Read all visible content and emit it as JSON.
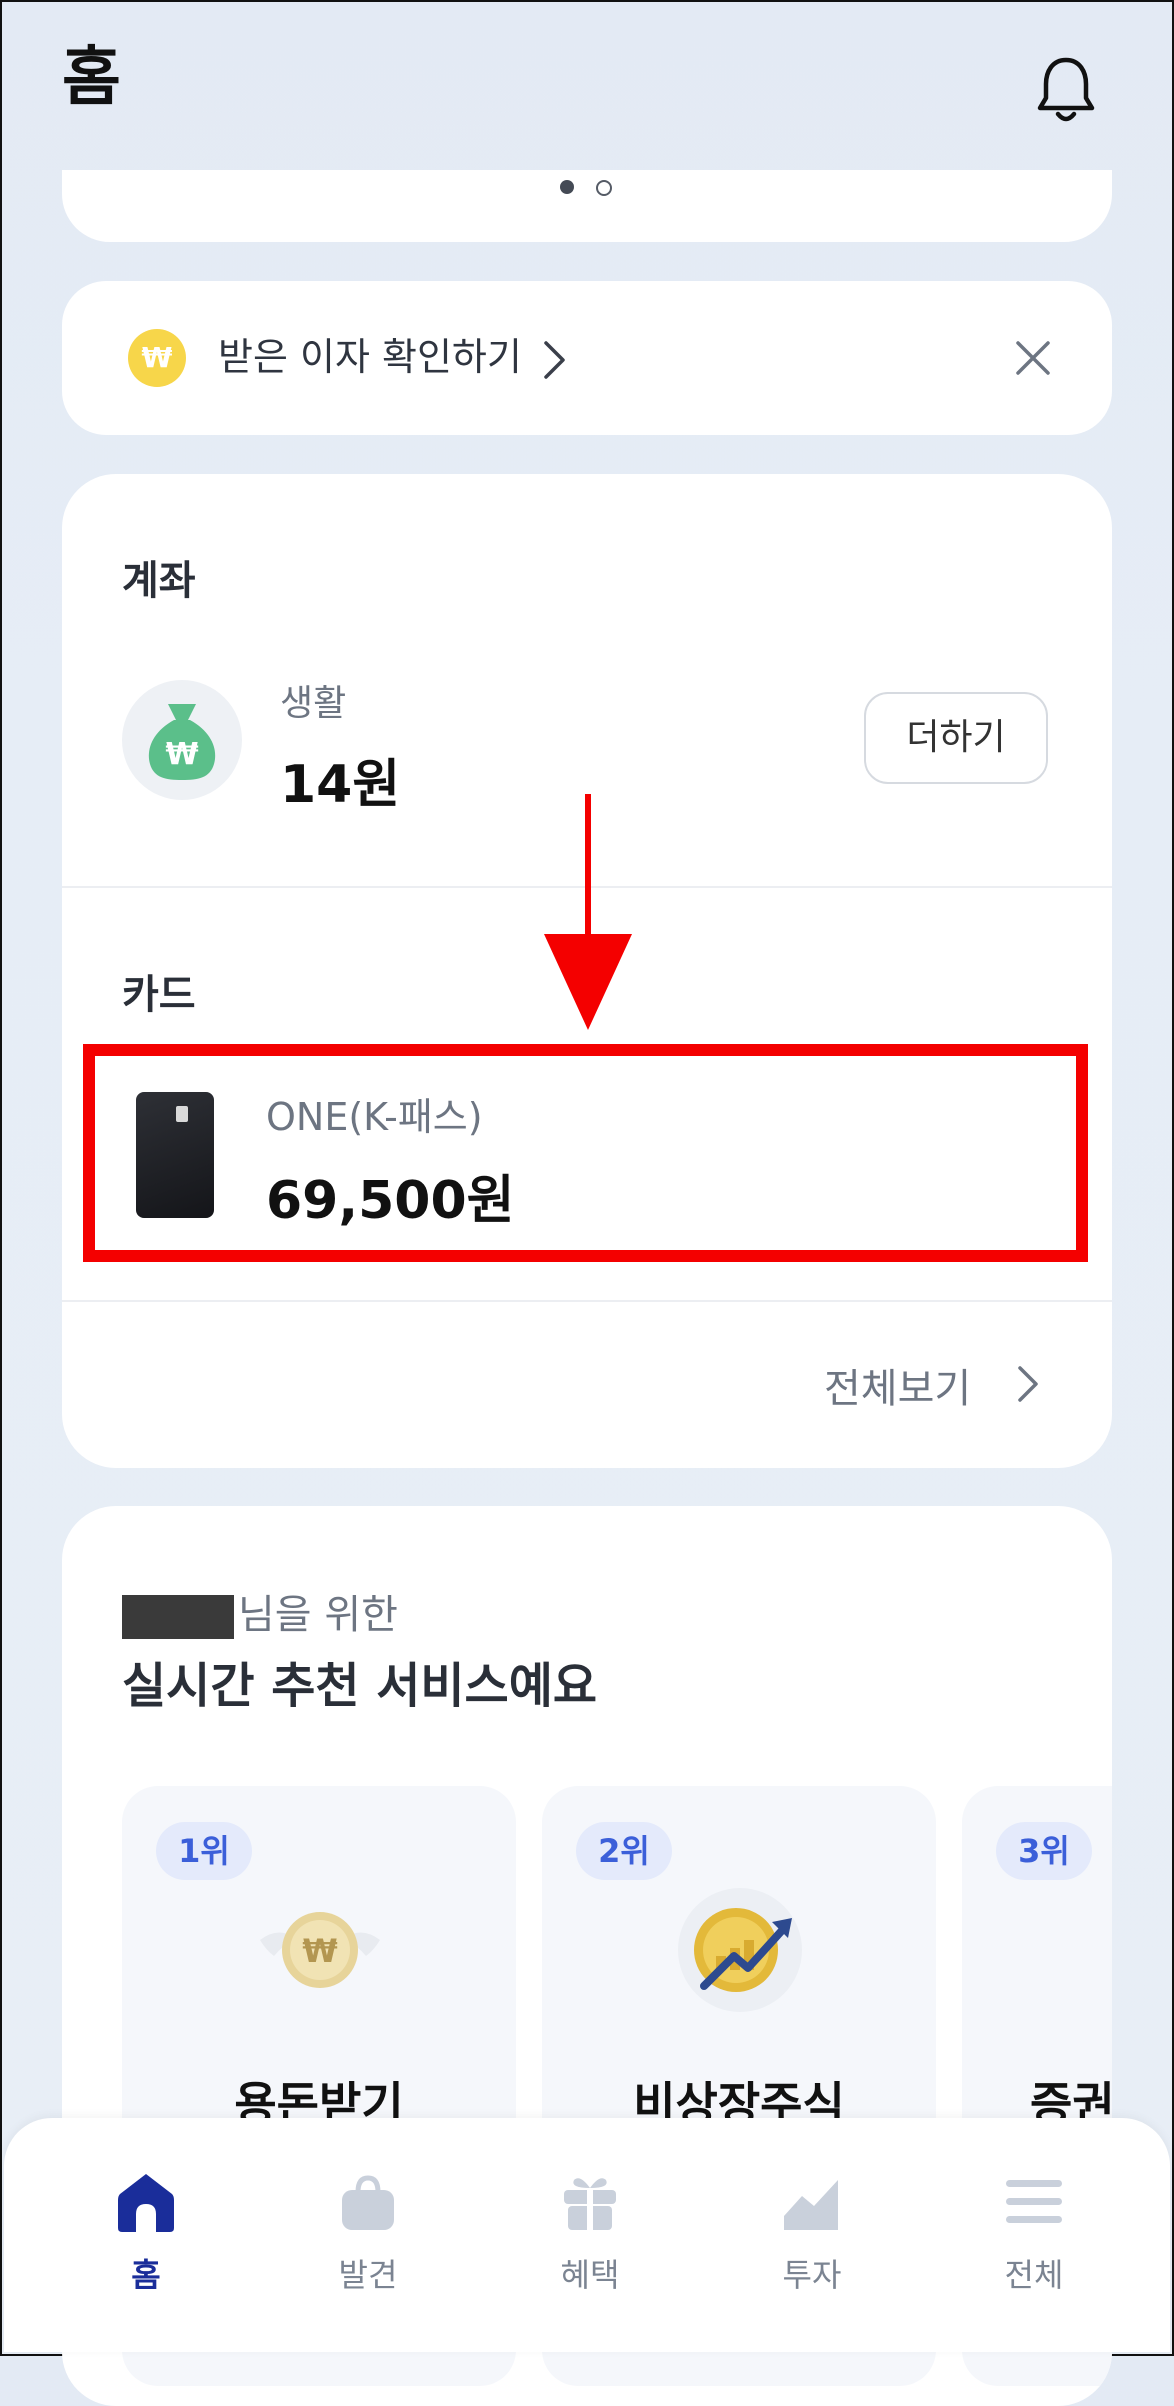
{
  "header": {
    "title": "홈",
    "notification_icon": "bell-icon"
  },
  "banner": {
    "pagination": {
      "total": 2,
      "active": 1
    }
  },
  "interest_notice": {
    "icon": "won-coin-icon",
    "text": "받은 이자 확인하기",
    "coin_symbol": "₩"
  },
  "assets": {
    "account_section_title": "계좌",
    "account": {
      "icon": "money-bag-icon",
      "name": "생활",
      "amount": "14원",
      "add_label": "더하기"
    },
    "card_section_title": "카드",
    "card": {
      "icon": "black-card-icon",
      "name": "ONE(K-패스)",
      "amount": "69,500원"
    },
    "view_all_label": "전체보기"
  },
  "annotation": {
    "color": "#f40000"
  },
  "recommend": {
    "subtitle_suffix": "님을 위한",
    "title": "실시간 추천 서비스예요",
    "items": [
      {
        "rank": "1위",
        "name": "용돈받기",
        "icon": "winged-coin-icon"
      },
      {
        "rank": "2위",
        "name": "비상장주식",
        "icon": "stock-growth-coin-icon"
      },
      {
        "rank": "3위",
        "name": "증권",
        "icon": "securities-icon"
      }
    ]
  },
  "nav": {
    "items": [
      {
        "label": "홈",
        "icon": "home-icon",
        "active": true
      },
      {
        "label": "발견",
        "icon": "shopping-bag-icon",
        "active": false
      },
      {
        "label": "혜택",
        "icon": "gift-icon",
        "active": false
      },
      {
        "label": "투자",
        "icon": "chart-icon",
        "active": false
      },
      {
        "label": "전체",
        "icon": "menu-icon",
        "active": false
      }
    ]
  },
  "colors": {
    "accent": "#1a2d9a",
    "rank_text": "#3b5fd9",
    "coin": "#f7d64a",
    "bag": "#5bbf8a"
  }
}
